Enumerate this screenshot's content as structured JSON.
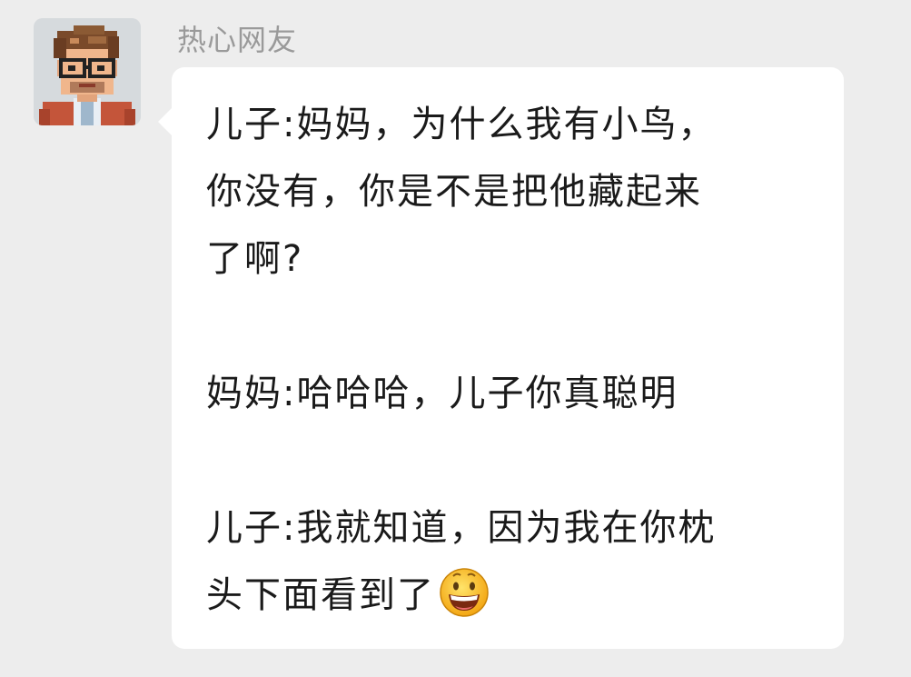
{
  "sender": {
    "name": "热心网友",
    "avatar_icon": "pixel-art-man-with-glasses-avatar"
  },
  "message": {
    "paragraph_1": {
      "line_1": "儿子:妈妈，为什么我有小鸟，",
      "line_2": "你没有，你是不是把他藏起来",
      "line_3": "了啊?"
    },
    "paragraph_2": {
      "line_1": "妈妈:哈哈哈，儿子你真聪明"
    },
    "paragraph_3": {
      "line_1": "儿子:我就知道，因为我在你枕",
      "line_2": "头下面看到了",
      "trailing_emoji": "grinning-face-emoji"
    }
  },
  "colors": {
    "background": "#ededed",
    "bubble": "#ffffff",
    "name_text": "#9a9a9a",
    "message_text": "#1a1a1a"
  }
}
